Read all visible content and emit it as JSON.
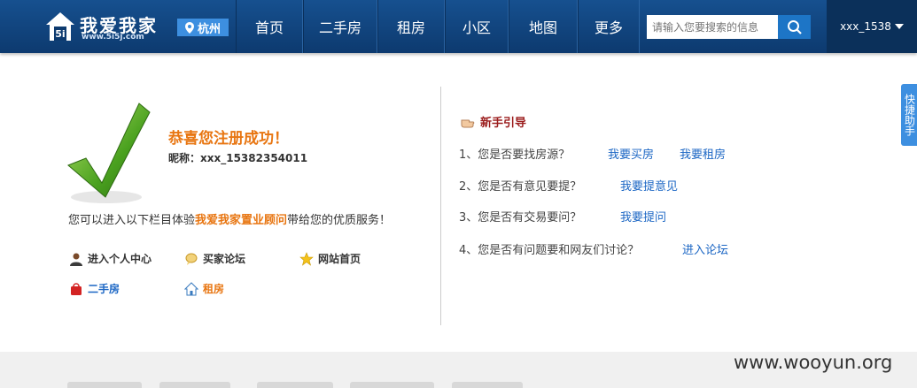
{
  "header": {
    "logo_title": "我爱我家",
    "logo_sub": "www.5i5j.com",
    "city": "杭州",
    "nav": [
      "首页",
      "二手房",
      "租房",
      "小区",
      "地图",
      "更多"
    ],
    "search_placeholder": "请输入您要搜索的信息",
    "username": "xxx_1538"
  },
  "main": {
    "congrats": "恭喜您注册成功！",
    "nickname": "昵称：xxx_15382354011",
    "intro_before": "您可以进入以下栏目体验",
    "intro_highlight": "我爱我家置业顾问",
    "intro_after": "带给您的优质服务！",
    "links": [
      "进入个人中心",
      "买家论坛",
      "网站首页",
      "二手房",
      "租房"
    ]
  },
  "guide": {
    "title": "新手引导",
    "questions": [
      {
        "q": "1、您是否要找房源？",
        "links": [
          "我要买房",
          "我要租房"
        ]
      },
      {
        "q": "2、您是否有意见要提？",
        "links": [
          "我要提意见"
        ]
      },
      {
        "q": "3、您是否有交易要问？",
        "links": [
          "我要提问"
        ]
      },
      {
        "q": "4、您是否有问题要和网友们讨论？",
        "links": [
          "进入论坛"
        ]
      }
    ]
  },
  "side_tab": "快捷助手",
  "watermark": "www.wooyun.org"
}
